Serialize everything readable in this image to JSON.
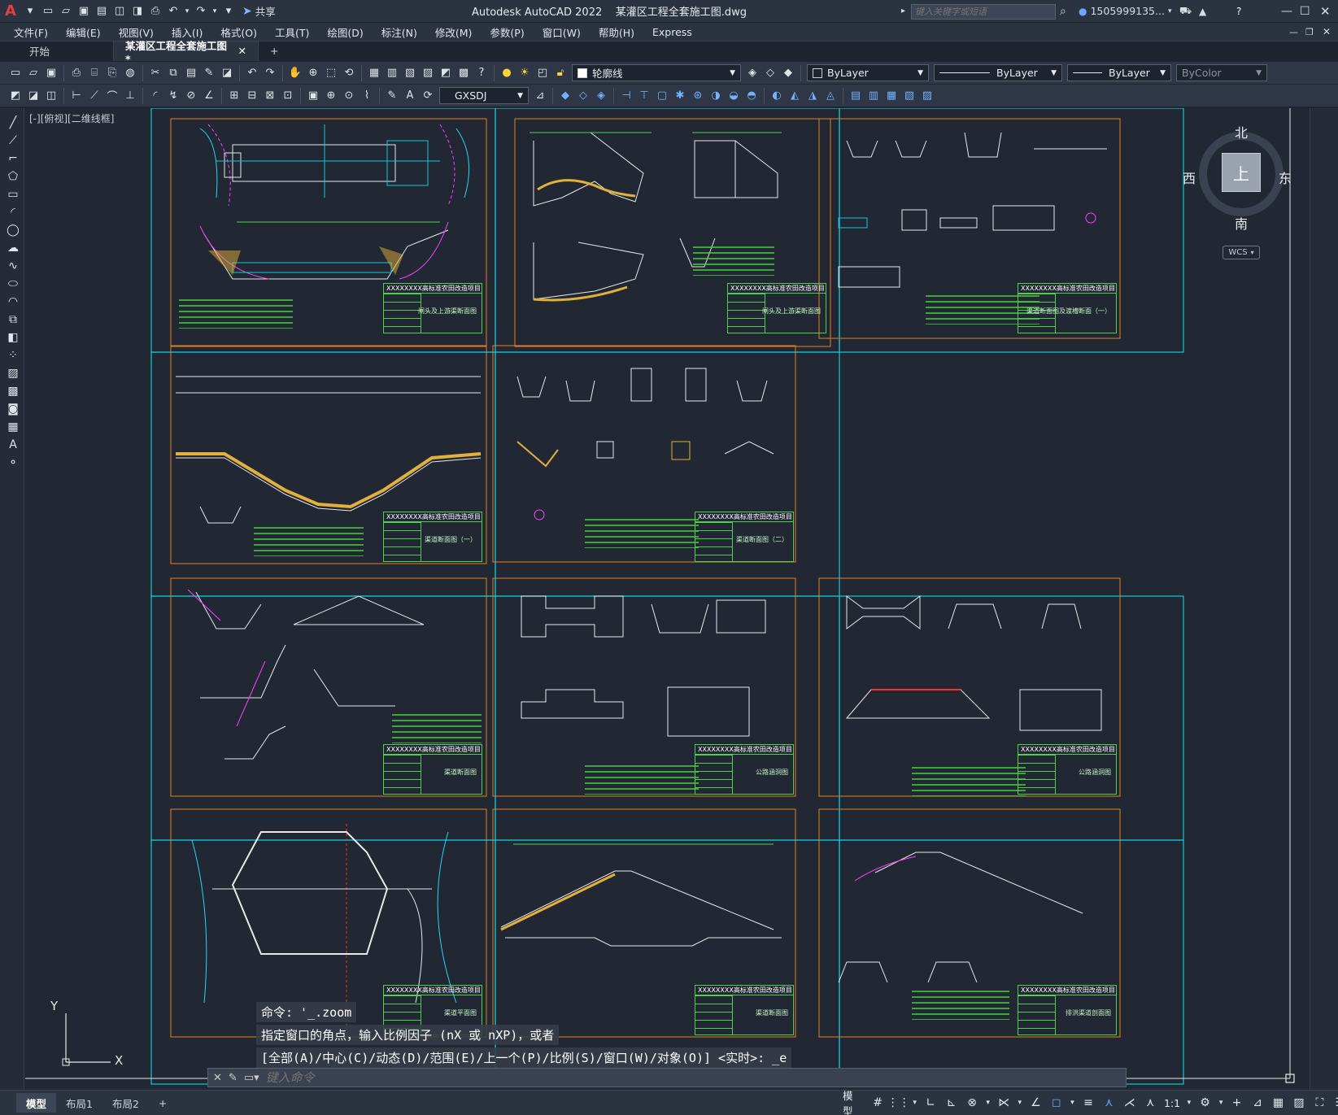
{
  "title": {
    "app_name": "Autodesk AutoCAD 2022",
    "file_name": "某灌区工程全套施工图.dwg",
    "share_label": "共享",
    "search_placeholder": "键入关键字或短语",
    "user": "1505999135...",
    "logo": "A"
  },
  "menubar": [
    "文件(F)",
    "编辑(E)",
    "视图(V)",
    "插入(I)",
    "格式(O)",
    "工具(T)",
    "绘图(D)",
    "标注(N)",
    "修改(M)",
    "参数(P)",
    "窗口(W)",
    "帮助(H)",
    "Express"
  ],
  "doc_tabs": {
    "start": "开始",
    "active": "某灌区工程全套施工图*",
    "new": "+"
  },
  "toolbar": {
    "layer_name": "轮廓线",
    "color": "ByLayer",
    "linetype": "ByLayer",
    "lineweight": "ByLayer",
    "plotstyle": "ByColor",
    "dimstyle": "GXSDJ"
  },
  "viewport_label": "[-][俯视][二维线框]",
  "viewcube": {
    "north": "北",
    "south": "南",
    "east": "东",
    "west": "西",
    "top": "上",
    "wcs": "WCS"
  },
  "ucs": {
    "y": "Y",
    "x": "X"
  },
  "command": {
    "history": [
      "命令: '_.zoom",
      "指定窗口的角点，输入比例因子 (nX 或 nXP)，或者",
      "[全部(A)/中心(C)/动态(D)/范围(E)/上一个(P)/比例(S)/窗口(W)/对象(O)] <实时>: _e"
    ],
    "placeholder": "键入命令"
  },
  "status_tabs": [
    "模型",
    "布局1",
    "布局2"
  ],
  "status": {
    "model_label": "模型",
    "scale": "1:1"
  },
  "sheets": [
    {
      "title_block": "XXXXXXXX高标准农田改造项目",
      "name": "闸头及上游渠断面图"
    },
    {
      "title_block": "XXXXXXXX高标准农田改造项目",
      "name": "闸头及上游渠断面图"
    },
    {
      "title_block": "XXXXXXXX高标准农田改造项目",
      "name": "渠道断面图及渡槽断面（一）"
    },
    {
      "title_block": "XXXXXXXX高标准农田改造项目",
      "name": "渠道断面图（一）"
    },
    {
      "title_block": "XXXXXXXX高标准农田改造项目",
      "name": "渠道断面图（二）"
    },
    {
      "title_block": "XXXXXXXX高标准农田改造项目",
      "name": "渠道断面图"
    },
    {
      "title_block": "XXXXXXXX高标准农田改造项目",
      "name": "公路涵洞图"
    },
    {
      "title_block": "XXXXXXXX高标准农田改造项目",
      "name": "公路涵洞图"
    },
    {
      "title_block": "XXXXXXXX高标准农田改造项目",
      "name": "渠道平面图"
    },
    {
      "title_block": "XXXXXXXX高标准农田改造项目",
      "name": "渠道断面图"
    },
    {
      "title_block": "XXXXXXXX高标准农田改造项目",
      "name": "排洪渠道剖面图"
    }
  ]
}
